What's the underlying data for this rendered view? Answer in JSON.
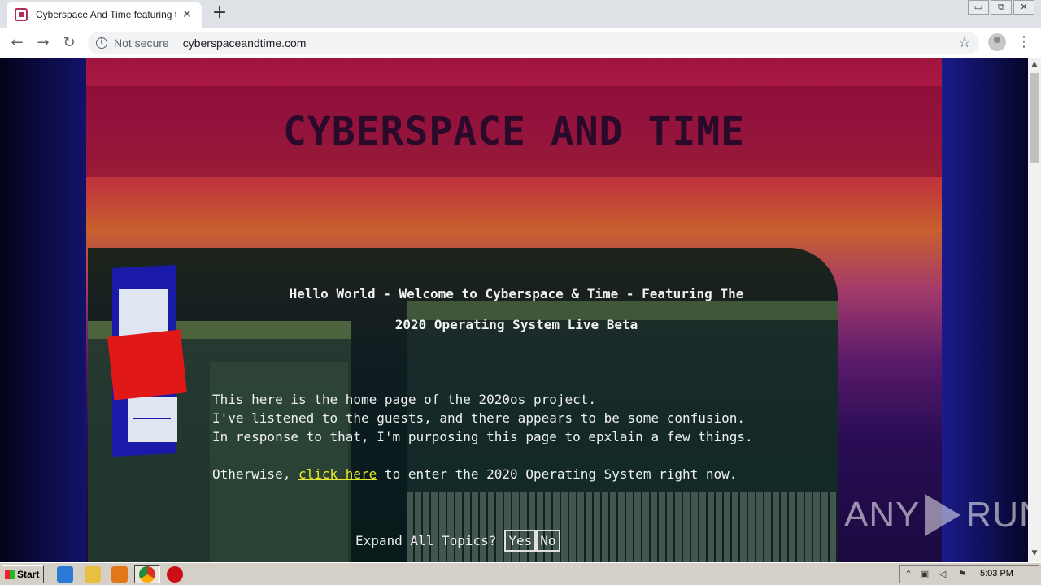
{
  "browser": {
    "tab_title": "Cyberspace And Time featuring the",
    "tab_close": "✕",
    "new_tab": "+",
    "security_label": "Not secure",
    "url": "cyberspaceandtime.com",
    "window_controls": {
      "minimize": "▭",
      "restore": "⧉",
      "close": "✕"
    }
  },
  "page": {
    "site_title": "CYBERSPACE AND TIME",
    "welcome_line1": "Hello World - Welcome to Cyberspace & Time - Featuring The",
    "welcome_line2": "2020 Operating System Live Beta",
    "body_lines": [
      "This here is the home page of the 2020os project.",
      "I've listened to the guests, and there appears to be some confusion.",
      "In response to that, I'm purposing this page to epxlain a few things."
    ],
    "otherwise_prefix": "Otherwise, ",
    "click_here": "click here",
    "otherwise_suffix": " to enter the 2020 Operating System right now.",
    "expand_label": "Expand All Topics?",
    "yes": "Yes",
    "no": "No"
  },
  "watermark": {
    "left": "ANY",
    "right": "RUN"
  },
  "taskbar": {
    "start": "Start",
    "clock": "5:03 PM",
    "icons": [
      "ie-icon",
      "explorer-icon",
      "media-player-icon",
      "chrome-icon",
      "opera-icon"
    ]
  },
  "colors": {
    "link": "#e8e830",
    "logo_blue": "#1a1aa8",
    "logo_red": "#e01818",
    "title_dark": "#2a0a2a"
  }
}
